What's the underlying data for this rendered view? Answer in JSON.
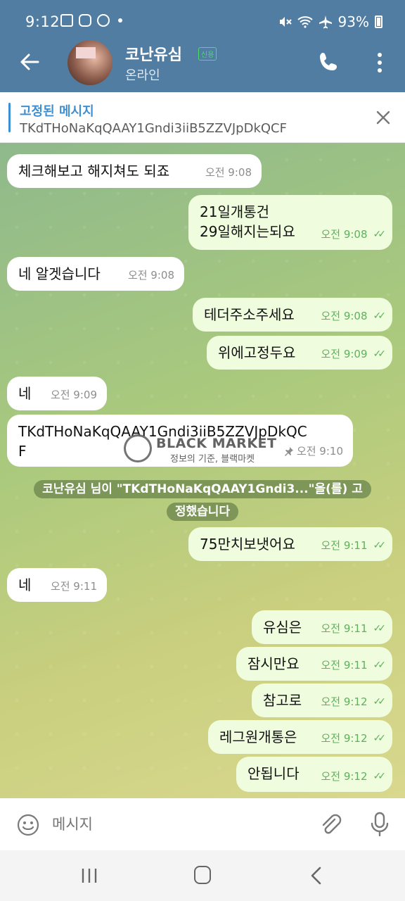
{
  "status_bar": {
    "time": "9:12",
    "battery": "93%"
  },
  "header": {
    "name": "코난유심",
    "badge": "신용",
    "status": "온라인"
  },
  "pinned": {
    "title": "고정된 메시지",
    "text": "TKdTHoNaKqQAAY1Gndi3iiB5ZZVJpDkQCF"
  },
  "messages": [
    {
      "dir": "in",
      "text": "체크해보고 해지쳐도 되죠",
      "time": "오전 9:08"
    },
    {
      "dir": "out",
      "text": "21일개통건\n29일해지는되요",
      "time": "오전 9:08"
    },
    {
      "dir": "in",
      "text": "네 알겟습니다",
      "time": "오전 9:08"
    },
    {
      "dir": "out",
      "text": "테더주소주세요",
      "time": "오전 9:08"
    },
    {
      "dir": "out",
      "text": "위에고정두요",
      "time": "오전 9:09"
    },
    {
      "dir": "in",
      "text": "네",
      "time": "오전 9:09"
    },
    {
      "dir": "in",
      "text": "TKdTHoNaKqQAAY1Gndi3iiB5ZZVJpDkQC\nF",
      "time": "오전 9:10"
    },
    {
      "dir": "out",
      "text": "75만치보냇어요",
      "time": "오전 9:11"
    },
    {
      "dir": "in",
      "text": "네",
      "time": "오전 9:11"
    },
    {
      "dir": "out",
      "text": "유심은",
      "time": "오전 9:11"
    },
    {
      "dir": "out",
      "text": "잠시만요",
      "time": "오전 9:11"
    },
    {
      "dir": "out",
      "text": "참고로",
      "time": "오전 9:12"
    },
    {
      "dir": "out",
      "text": "레그원개통은",
      "time": "오전 9:12"
    },
    {
      "dir": "out",
      "text": "안됩니다",
      "time": "오전 9:12"
    }
  ],
  "system_message": "코난유심 님이 \"TKdTHoNaKqQAAY1Gndi3...\"을(를) 고정했습니다",
  "watermark": {
    "title": "BLACK MARKET",
    "subtitle": "정보의 기준, 블랙마켓",
    "logo_text": "BLACK MARKET"
  },
  "composer": {
    "placeholder": "메시지"
  },
  "colors": {
    "header": "#517da2",
    "outgoing_bubble": "#effdde",
    "incoming_bubble": "#ffffff",
    "read_checks": "#5db25b"
  }
}
